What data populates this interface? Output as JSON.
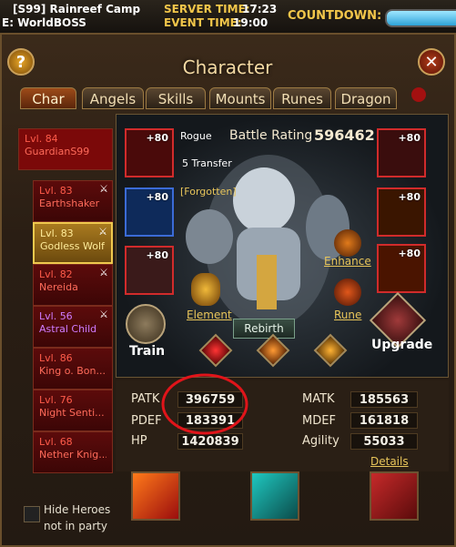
{
  "topbar": {
    "server_line": "[S99] Rainreef Camp",
    "event_line": "E: WorldBOSS",
    "server_time_label": "SERVER TIME:",
    "server_time": "17:23",
    "event_time_label": "EVENT TIME:",
    "event_time": "19:00",
    "countdown_label": "COUNTDOWN:"
  },
  "window": {
    "title": "Character",
    "help_label": "?",
    "close_label": "✕"
  },
  "tabs": [
    "Char",
    "Angels",
    "Skills",
    "Mounts",
    "Runes",
    "Dragon"
  ],
  "heroes": [
    {
      "level": "Lvl. 84",
      "name": "GuardianS99"
    },
    {
      "level": "Lvl. 83",
      "name": "Earthshaker"
    },
    {
      "level": "Lvl. 83",
      "name": "Godless Wolf"
    },
    {
      "level": "Lvl. 82",
      "name": "Nereida"
    },
    {
      "level": "Lvl. 56",
      "name": "Astral Child"
    },
    {
      "level": "Lvl. 86",
      "name": "King o. Bon..."
    },
    {
      "level": "Lvl. 76",
      "name": "Night Senti..."
    },
    {
      "level": "Lvl. 68",
      "name": "Nether Knig..."
    }
  ],
  "hide_heroes_label": "Hide Heroes not in party",
  "character": {
    "class": "Rogue",
    "battle_rating_label": "Battle Rating",
    "battle_rating": "596462",
    "transfer": "5 Transfer",
    "title": "[Forgotten]",
    "plus_labels": [
      "+80",
      "+80",
      "+80",
      "+80",
      "+80",
      "+80"
    ],
    "enhance_label": "Enhance",
    "element_label": "Element",
    "rune_label": "Rune",
    "rebirth_label": "Rebirth",
    "train_label": "Train",
    "upgrade_label": "Upgrade"
  },
  "stats": {
    "patk_label": "PATK",
    "patk": "396759",
    "pdef_label": "PDEF",
    "pdef": "183391",
    "hp_label": "HP",
    "hp": "1420839",
    "matk_label": "MATK",
    "matk": "185563",
    "mdef_label": "MDEF",
    "mdef": "161818",
    "agility_label": "Agility",
    "agility": "55033"
  },
  "details_label": "Details",
  "colors": {
    "accent": "#e8c55a",
    "hero_red": "#7b0909",
    "highlight_circle": "#e0141a"
  }
}
